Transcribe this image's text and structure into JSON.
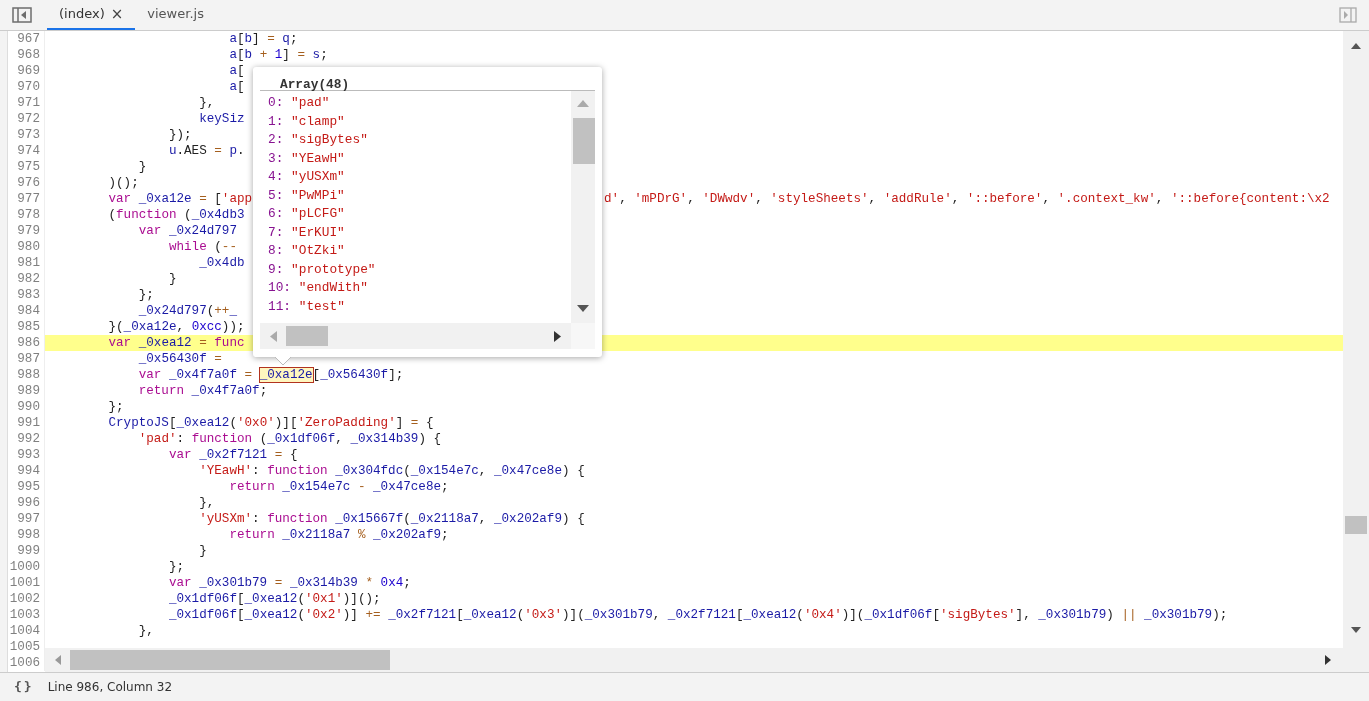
{
  "tabs": [
    {
      "label": "(index)",
      "close": "×",
      "selected": true
    },
    {
      "label": "viewer.js",
      "selected": false
    }
  ],
  "editor": {
    "lines": [
      {
        "number": "967",
        "current": false,
        "parts": [
          {
            "kind": "code",
            "text": "                        a[b] = q;"
          }
        ]
      },
      {
        "number": "968",
        "current": false,
        "parts": [
          {
            "kind": "code",
            "text": "                        a[b + 1] = s;"
          }
        ]
      },
      {
        "number": "969",
        "current": false,
        "parts": [
          {
            "kind": "code",
            "text": "                        a["
          }
        ]
      },
      {
        "number": "970",
        "current": false,
        "parts": [
          {
            "kind": "code",
            "text": "                        a["
          }
        ]
      },
      {
        "number": "971",
        "current": false,
        "parts": [
          {
            "kind": "code",
            "text": "                    },"
          }
        ]
      },
      {
        "number": "972",
        "current": false,
        "parts": [
          {
            "kind": "code",
            "text": "                    keySiz"
          }
        ]
      },
      {
        "number": "973",
        "current": false,
        "parts": [
          {
            "kind": "code",
            "text": "                });"
          }
        ]
      },
      {
        "number": "974",
        "current": false,
        "parts": [
          {
            "kind": "code",
            "text": "                u.AES = p."
          }
        ]
      },
      {
        "number": "975",
        "current": false,
        "parts": [
          {
            "kind": "code",
            "text": "            }"
          }
        ]
      },
      {
        "number": "976",
        "current": false,
        "parts": [
          {
            "kind": "code",
            "text": "        )();"
          }
        ]
      },
      {
        "number": "977",
        "current": false,
        "parts": [
          {
            "kind": "keyword",
            "text": "        var"
          },
          {
            "kind": "code",
            "text": " _0xa12e = ['app"
          }
        ],
        "tail": [
          {
            "kind": "string",
            "text": "d'"
          },
          {
            "kind": "code",
            "text": ", 'mPDrG', 'DWwdv', 'styleSheets', 'addRule', '::before', '.context_kw', '::before{content:\\x2"
          }
        ]
      },
      {
        "number": "978",
        "current": false,
        "parts": [
          {
            "kind": "code",
            "text": "        ("
          },
          {
            "kind": "keyword",
            "text": "function"
          },
          {
            "kind": "code",
            "text": " (_0x4db3"
          }
        ]
      },
      {
        "number": "979",
        "current": false,
        "parts": [
          {
            "kind": "keyword",
            "text": "            var"
          },
          {
            "kind": "code",
            "text": " _0x24d797"
          }
        ]
      },
      {
        "number": "980",
        "current": false,
        "parts": [
          {
            "kind": "keyword",
            "text": "                while"
          },
          {
            "kind": "code",
            "text": " (--"
          }
        ]
      },
      {
        "number": "981",
        "current": false,
        "parts": [
          {
            "kind": "code",
            "text": "                    _0x4db"
          }
        ]
      },
      {
        "number": "982",
        "current": false,
        "parts": [
          {
            "kind": "code",
            "text": "                }"
          }
        ]
      },
      {
        "number": "983",
        "current": false,
        "parts": [
          {
            "kind": "code",
            "text": "            };"
          }
        ]
      },
      {
        "number": "984",
        "current": false,
        "parts": [
          {
            "kind": "code",
            "text": "            _0x24d797(++_"
          }
        ]
      },
      {
        "number": "985",
        "current": false,
        "parts": [
          {
            "kind": "code",
            "text": "        }(_0xa12e, 0xcc));"
          }
        ]
      },
      {
        "number": "986",
        "current": true,
        "parts": [
          {
            "kind": "keyword",
            "text": "        var"
          },
          {
            "kind": "code",
            "text": " _0xea12 = "
          },
          {
            "kind": "keyword",
            "text": "func"
          }
        ]
      },
      {
        "number": "987",
        "current": false,
        "parts": [
          {
            "kind": "code",
            "text": "            _0x56430f ="
          }
        ]
      },
      {
        "number": "988",
        "current": false,
        "parts": [
          {
            "kind": "keyword",
            "text": "            var"
          },
          {
            "kind": "code",
            "text": " _0x4f7a0f = "
          },
          {
            "kind": "hover",
            "text": "_0xa12e"
          },
          {
            "kind": "code",
            "text": "[_0x56430f];"
          }
        ]
      },
      {
        "number": "989",
        "current": false,
        "parts": [
          {
            "kind": "keyword",
            "text": "            return"
          },
          {
            "kind": "code",
            "text": " _0x4f7a0f;"
          }
        ]
      },
      {
        "number": "990",
        "current": false,
        "parts": [
          {
            "kind": "code",
            "text": "        };"
          }
        ]
      },
      {
        "number": "991",
        "current": false,
        "parts": [
          {
            "kind": "code",
            "text": "        CryptoJS[_0xea12('0x0')]['ZeroPadding'] = {"
          }
        ]
      },
      {
        "number": "992",
        "current": false,
        "parts": [
          {
            "kind": "code",
            "text": "            'pad': "
          },
          {
            "kind": "keyword",
            "text": "function"
          },
          {
            "kind": "code",
            "text": " (_0x1df06f, _0x314b39) {"
          }
        ]
      },
      {
        "number": "993",
        "current": false,
        "parts": [
          {
            "kind": "keyword",
            "text": "                var"
          },
          {
            "kind": "code",
            "text": " _0x2f7121 = {"
          }
        ]
      },
      {
        "number": "994",
        "current": false,
        "parts": [
          {
            "kind": "code",
            "text": "                    'YEawH': "
          },
          {
            "kind": "keyword",
            "text": "function"
          },
          {
            "kind": "code",
            "text": " _0x304fdc(_0x154e7c, _0x47ce8e) {"
          }
        ]
      },
      {
        "number": "995",
        "current": false,
        "parts": [
          {
            "kind": "keyword",
            "text": "                        return"
          },
          {
            "kind": "code",
            "text": " _0x154e7c - _0x47ce8e;"
          }
        ]
      },
      {
        "number": "996",
        "current": false,
        "parts": [
          {
            "kind": "code",
            "text": "                    },"
          }
        ]
      },
      {
        "number": "997",
        "current": false,
        "parts": [
          {
            "kind": "code",
            "text": "                    'yUSXm': "
          },
          {
            "kind": "keyword",
            "text": "function"
          },
          {
            "kind": "code",
            "text": " _0x15667f(_0x2118a7, _0x202af9) {"
          }
        ]
      },
      {
        "number": "998",
        "current": false,
        "parts": [
          {
            "kind": "keyword",
            "text": "                        return"
          },
          {
            "kind": "code",
            "text": " _0x2118a7 % _0x202af9;"
          }
        ]
      },
      {
        "number": "999",
        "current": false,
        "parts": [
          {
            "kind": "code",
            "text": "                    }"
          }
        ]
      },
      {
        "number": "1000",
        "current": false,
        "parts": [
          {
            "kind": "code",
            "text": "                };"
          }
        ]
      },
      {
        "number": "1001",
        "current": false,
        "parts": [
          {
            "kind": "keyword",
            "text": "                var"
          },
          {
            "kind": "code",
            "text": " _0x301b79 = _0x314b39 * 0x4;"
          }
        ]
      },
      {
        "number": "1002",
        "current": false,
        "parts": [
          {
            "kind": "code",
            "text": "                _0x1df06f[_0xea12('0x1')]();"
          }
        ]
      },
      {
        "number": "1003",
        "current": false,
        "parts": [
          {
            "kind": "code",
            "text": "                _0x1df06f[_0xea12('0x2')] += _0x2f7121[_0xea12('0x3')](_0x301b79, _0x2f7121[_0xea12('0x4')](_0x1df06f['sigBytes'], _0x301b79) || _0x301b79);"
          }
        ]
      },
      {
        "number": "1004",
        "current": false,
        "parts": [
          {
            "kind": "code",
            "text": "            },"
          }
        ]
      },
      {
        "number": "1005"
      },
      {
        "number": "1006"
      }
    ]
  },
  "popup": {
    "title": "Array(48)",
    "items": [
      {
        "index": "0:",
        "value": "\"pad\""
      },
      {
        "index": "1:",
        "value": "\"clamp\""
      },
      {
        "index": "2:",
        "value": "\"sigBytes\""
      },
      {
        "index": "3:",
        "value": "\"YEawH\""
      },
      {
        "index": "4:",
        "value": "\"yUSXm\""
      },
      {
        "index": "5:",
        "value": "\"PwMPi\""
      },
      {
        "index": "6:",
        "value": "\"pLCFG\""
      },
      {
        "index": "7:",
        "value": "\"ErKUI\""
      },
      {
        "index": "8:",
        "value": "\"OtZki\""
      },
      {
        "index": "9:",
        "value": "\"prototype\""
      },
      {
        "index": "10:",
        "value": "\"endWith\""
      },
      {
        "index": "11:",
        "value": "\"test\""
      }
    ]
  },
  "status_bar": {
    "format_button": "{}",
    "position": "Line 986, Column 32"
  }
}
